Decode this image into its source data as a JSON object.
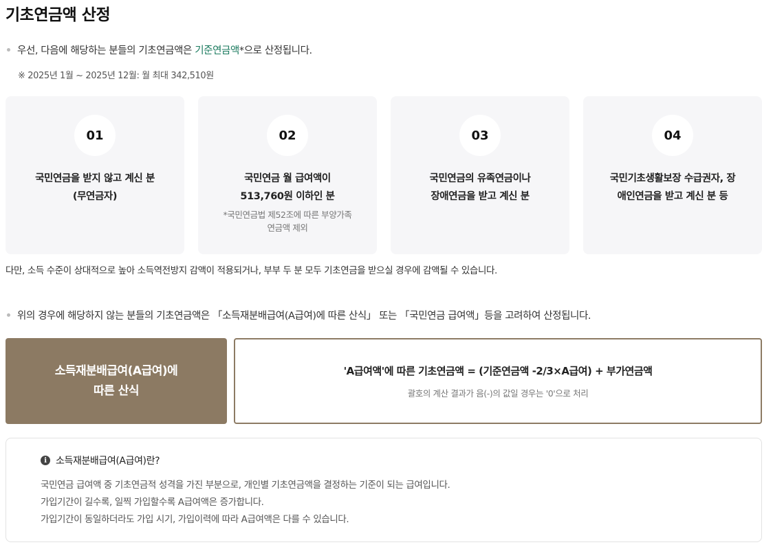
{
  "title": "기초연금액 산정",
  "intro": {
    "before": "우선, 다음에 해당하는 분들의 기초연금액은 ",
    "highlight": "기준연금액",
    "after": "*으로 산정됩니다.",
    "accent_color": "#1a7a5e"
  },
  "note": "※ 2025년 1월 ~ 2025년 12월: 월 최대 342,510원",
  "cards": [
    {
      "num": "01",
      "line1": "국민연금을 받지 않고 계신 분",
      "line2": "(무연금자)",
      "sub1": "",
      "sub2": ""
    },
    {
      "num": "02",
      "line1": "국민연금 월 급여액이",
      "line2": "513,760원 이하인 분",
      "sub1": "*국민연금법 제52조에 따른 부양가족",
      "sub2": "연금액 제외"
    },
    {
      "num": "03",
      "line1": "국민연금의 유족연금이나",
      "line2": "장애연금을 받고 계신 분",
      "sub1": "",
      "sub2": ""
    },
    {
      "num": "04",
      "line1": "국민기초생활보장 수급권자, 장",
      "line2": "애인연금을 받고 계신 분 등",
      "sub1": "",
      "sub2": ""
    }
  ],
  "after_cards": "다만, 소득 수준이 상대적으로 높아 소득역전방지 감액이 적용되거나, 부부 두 분 모두 기초연금을 받으실 경우에 감액될 수 있습니다.",
  "second_bullet": "위의 경우에 해당하지 않는 분들의 기초연금액은 「소득재분배급여(A급여)에 따른 산식」 또는 「국민연금 급여액」등을 고려하여 산정됩니다.",
  "formula": {
    "left_line1": "소득재분배급여(A급여)에",
    "left_line2": "따른 산식",
    "main": "'A급여액'에 따른 기초연금액 = (기준연금액 -2/3×A급여) + 부가연금액",
    "sub": "괄호의 계산 결과가 음(-)의 값일 경우는 '0'으로 처리",
    "brand_color": "#8c7a63"
  },
  "info": {
    "icon": "info-icon",
    "icon_glyph": "i",
    "heading": "소득재분배급여(A급여)란?",
    "lines": [
      "국민연금 급여액 중 기초연금적 성격을 가진 부분으로, 개인별 기초연금액을 결정하는 기준이 되는 급여입니다.",
      "가입기간이 길수록, 일찍 가입할수록 A급여액은 증가합니다.",
      "가입기간이 동일하더라도 가입 시기, 가입이력에 따라 A급여액은 다를 수 있습니다."
    ]
  }
}
